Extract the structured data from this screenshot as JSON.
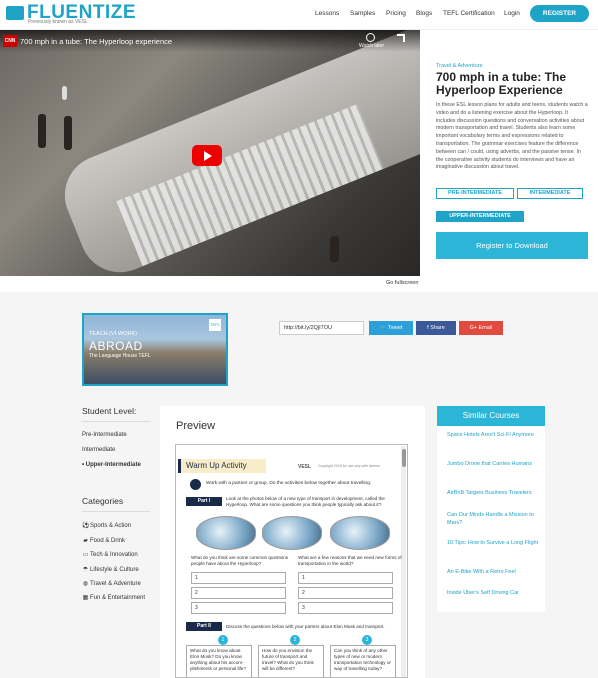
{
  "header": {
    "logo_text": "FLUENTIZE",
    "logo_sub": "Previously known as VESL",
    "nav": [
      "Lessons",
      "Samples",
      "Pricing",
      "Blogs",
      "TEFL Certification",
      "Login"
    ],
    "register_label": "REGISTER",
    "accent": "#1fa3c7"
  },
  "video": {
    "channel_badge": "CNN",
    "title": "700 mph in a tube: The Hyperloop experience",
    "watch_later": "Watch later",
    "fullscreen_label": "Go fullscreen"
  },
  "lesson": {
    "tag": "Travel & Adventure",
    "title": "700 mph in a tube: The Hyperloop Experience",
    "description": "In these ESL lesson plans for adults and teens, students watch a video and do a listening exercise about the Hyperloop. It includes discussion questions and conversation activities about modern transportation and travel. Students also learn some important vocabulary terms and expressions related to transportation. The grammar exercises feature the difference between can / could, using adverbs, and the passive tense. In the cooperative activity students do interviews and have an imaginative discussion about travel.",
    "levels": [
      "PRE-INTERMEDIATE",
      "INTERMEDIATE",
      "UPPER-INTERMEDIATE"
    ],
    "download_label": "Register to Download"
  },
  "promo": {
    "line1": "TEACH (VI-WORK)",
    "line2": "ABROAD",
    "line3": "The Language House TEFL",
    "corner": "TEFL"
  },
  "share": {
    "url": "http://bit.ly/2QjI7OU",
    "tweet": "Tweet",
    "facebook": "Share",
    "google": "Email",
    "tweet_color": "#2d9fd9",
    "facebook_color": "#3b5998",
    "google_color": "#e04a3f"
  },
  "left": {
    "level_heading": "Student Level:",
    "levels": [
      "Pre-Intermediate",
      "Intermediate",
      "• Upper-Intermediate"
    ],
    "categories_heading": "Categories",
    "categories": [
      {
        "icon": "soccer-ball-icon",
        "glyph": "⚽",
        "label": "Sports & Action"
      },
      {
        "icon": "food-icon",
        "glyph": "▰",
        "label": "Food & Drink"
      },
      {
        "icon": "computer-icon",
        "glyph": "▭",
        "label": "Tech & Innovation"
      },
      {
        "icon": "umbrella-icon",
        "glyph": "☂",
        "label": "Lifestyle & Culture"
      },
      {
        "icon": "globe-icon",
        "glyph": "◍",
        "label": "Travel & Adventure"
      },
      {
        "icon": "film-icon",
        "glyph": "▦",
        "label": "Fun & Entertainment"
      }
    ]
  },
  "preview": {
    "heading": "Preview",
    "doc": {
      "warmup": "Warm Up Activity",
      "vesl": "VESL",
      "copyright": "Copyright 2018 for use only with license",
      "intro": "Work with a partner or group. Do the activities below together about travelling.",
      "part1": "Part I",
      "part1_text": "Look at the photos below of a new type of transport in development, called the Hyperloop. What are some questions you think people typically ask about it?",
      "q_left": "What do you think are some common questions people have about the Hyperloop?",
      "q_right": "What are a few reasons that we need new forms of transportation in the world?",
      "answers": [
        "1",
        "2",
        "3"
      ],
      "part2": "Part II",
      "part2_text": "Discuss the questions below with your partner about Elon Musk and transport.",
      "cards": [
        {
          "num": "1",
          "text": "What do you know about Elon Musk? Do you know anything about his accom-plishments or personal life?"
        },
        {
          "num": "2",
          "text": "How do you envision the future of transport and travel? What do you think will be different?"
        },
        {
          "num": "3",
          "text": "Can you think of any other types of new or modern transportation technology or way of travelling today?"
        }
      ]
    }
  },
  "similar": {
    "heading": "Similar Courses",
    "items": [
      "Space Hotels Aren't Sci-Fi Anymore",
      "Jumbo Drone that Carries Humans",
      "AirBnB Targets Business Travelers",
      "Can Our Minds Handle a Mission to Mars?",
      "10 Tips: How to Survive a Long Flight",
      "An E-Bike With a Retro Feel",
      "Inside Uber's Self Driving Car"
    ]
  }
}
